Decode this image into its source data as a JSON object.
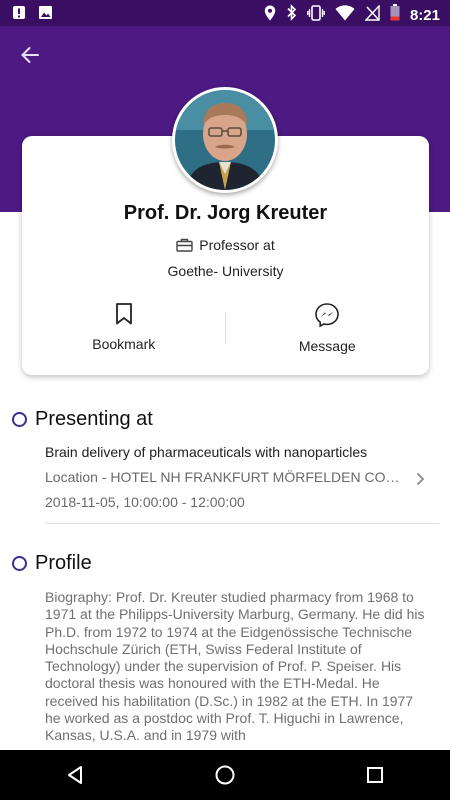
{
  "status_bar": {
    "time": "8:21",
    "left_icons": [
      "notification-icon",
      "image-icon"
    ],
    "right_icons": [
      "location-icon",
      "bluetooth-icon",
      "vibrate-icon",
      "wifi-icon",
      "no-sim-icon",
      "battery-low-icon"
    ]
  },
  "colors": {
    "header": "#4c1a82",
    "status_bar": "#3a0f63",
    "accent": "#3c2f8f"
  },
  "profile": {
    "name": "Prof. Dr. Jorg Kreuter",
    "title": "Professor at",
    "organization": "Goethe- University",
    "actions": {
      "bookmark": "Bookmark",
      "message": "Message"
    }
  },
  "presenting": {
    "heading": "Presenting at",
    "session": {
      "title": "Brain delivery of pharmaceuticals with nanoparticles",
      "location": "Location - HOTEL NH FRANKFURT MÖRFELDEN CONFERENCE CENTER",
      "time": "2018-11-05, 10:00:00 - 12:00:00"
    }
  },
  "profile_section": {
    "heading": "Profile",
    "biography": "Biography: Prof. Dr. Kreuter studied pharmacy from 1968 to 1971 at the Philipps-University Marburg, Germany. He did his Ph.D. from 1972 to 1974 at the Eidgenössische Technische Hochschule Zürich (ETH, Swiss Federal Institute of Technology) under the supervision of Prof. P. Speiser. His doctoral thesis was honoured with the ETH-Medal. He received his habilitation (D.Sc.) in 1982 at the ETH. In 1977 he worked as a postdoc with Prof. T. Higuchi in Lawrence, Kansas, U.S.A. and in 1979 with"
  },
  "nav": [
    "back-triangle-icon",
    "home-circle-icon",
    "recents-square-icon"
  ]
}
